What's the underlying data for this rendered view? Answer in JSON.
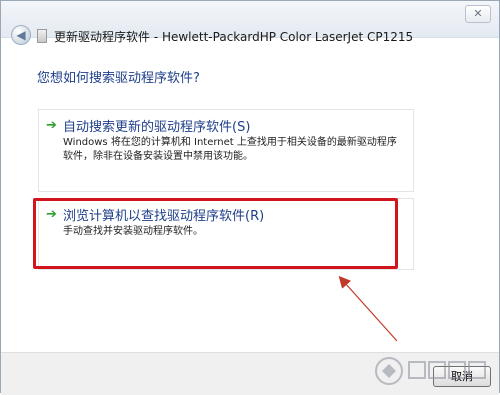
{
  "window": {
    "title": "更新驱动程序软件 - Hewlett-PackardHP Color LaserJet CP1215",
    "close_glyph": "✕",
    "back_glyph": "◀"
  },
  "main": {
    "question": "您想如何搜索驱动程序软件?"
  },
  "options": [
    {
      "title": "自动搜索更新的驱动程序软件(S)",
      "description": "Windows 将在您的计算机和 Internet 上查找用于相关设备的最新驱动程序软件，除非在设备安装设置中禁用该功能。",
      "arrow_glyph": "➔"
    },
    {
      "title": "浏览计算机以查找驱动程序软件(R)",
      "description": "手动查找并安装驱动程序软件。",
      "arrow_glyph": "➔"
    }
  ],
  "footer": {
    "cancel_label": "取消"
  },
  "colors": {
    "highlight": "#d2151c",
    "link_blue": "#1f3f8a",
    "arrow_green": "#2ea02e"
  },
  "icons": [
    "back-arrow-icon",
    "device-icon",
    "close-icon",
    "green-arrow-icon"
  ]
}
